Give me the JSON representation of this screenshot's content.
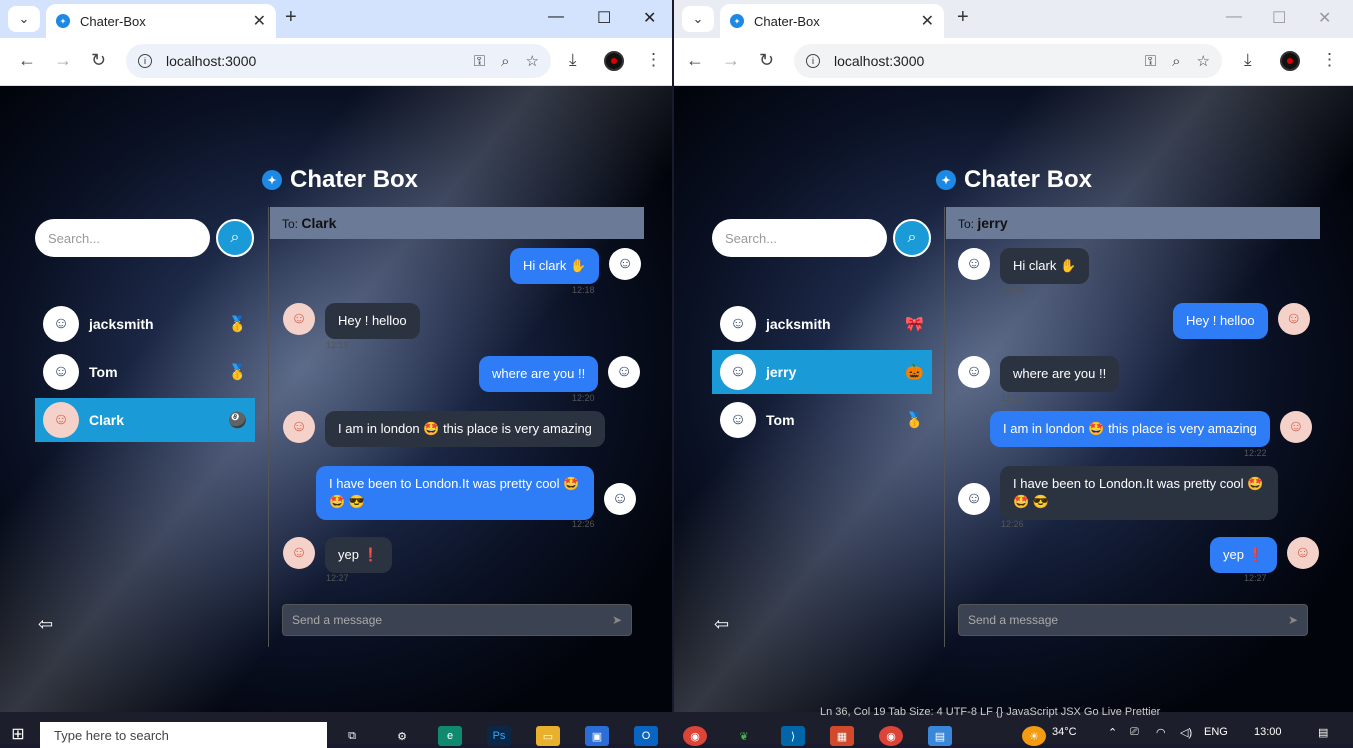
{
  "browser_left": {
    "tab_title": "Chater-Box",
    "url": "localhost:3000",
    "app_title": "Chater Box",
    "search_placeholder": "Search...",
    "contacts": [
      {
        "name": "jacksmith",
        "badge": "🥇"
      },
      {
        "name": "Tom",
        "badge": "🥇"
      },
      {
        "name": "Clark",
        "badge": "🎱"
      }
    ],
    "to_prefix": "To:",
    "to_name": "Clark",
    "messages": [
      {
        "text": "Hi clark ✋",
        "time": "12:18"
      },
      {
        "text": "Hey ! helloo",
        "time": "12:19"
      },
      {
        "text": "where are you !!",
        "time": "12:20"
      },
      {
        "text": "I am in london 🤩 this place is very amazing",
        "time": ""
      },
      {
        "text": "I have been to London.It was pretty cool 🤩 🤩 😎",
        "time": "12:26"
      },
      {
        "text": "yep ❗",
        "time": "12:27"
      }
    ],
    "compose_placeholder": "Send a message"
  },
  "browser_right": {
    "tab_title": "Chater-Box",
    "url": "localhost:3000",
    "app_title": "Chater Box",
    "search_placeholder": "Search...",
    "contacts": [
      {
        "name": "jacksmith",
        "badge": "🎀"
      },
      {
        "name": "jerry",
        "badge": "🎃"
      },
      {
        "name": "Tom",
        "badge": "🥇"
      }
    ],
    "to_prefix": "To:",
    "to_name": "jerry",
    "messages": [
      {
        "text": "Hi clark ✋",
        "time": "12:18"
      },
      {
        "text": "Hey ! helloo",
        "time": ""
      },
      {
        "text": "where are you !!",
        "time": "12:20"
      },
      {
        "text": "I am in london 🤩 this place is very amazing",
        "time": "12:22"
      },
      {
        "text": "I have been to London.It was pretty cool 🤩 🤩 😎",
        "time": "12:26"
      },
      {
        "text": "yep ❗",
        "time": "12:27"
      }
    ],
    "compose_placeholder": "Send a message"
  },
  "taskbar": {
    "search_placeholder": "Type here to search",
    "weather": "34°C",
    "lang": "ENG",
    "clock": "13:00",
    "editor_status": "Ln 36, Col 19   Tab Size: 4   UTF-8   LF   {} JavaScript JSX   Go Live   Prettier"
  },
  "colors": {
    "accent": "#1a9bd8",
    "outgoing": "#2e7cf6",
    "incoming": "#2b3240"
  }
}
